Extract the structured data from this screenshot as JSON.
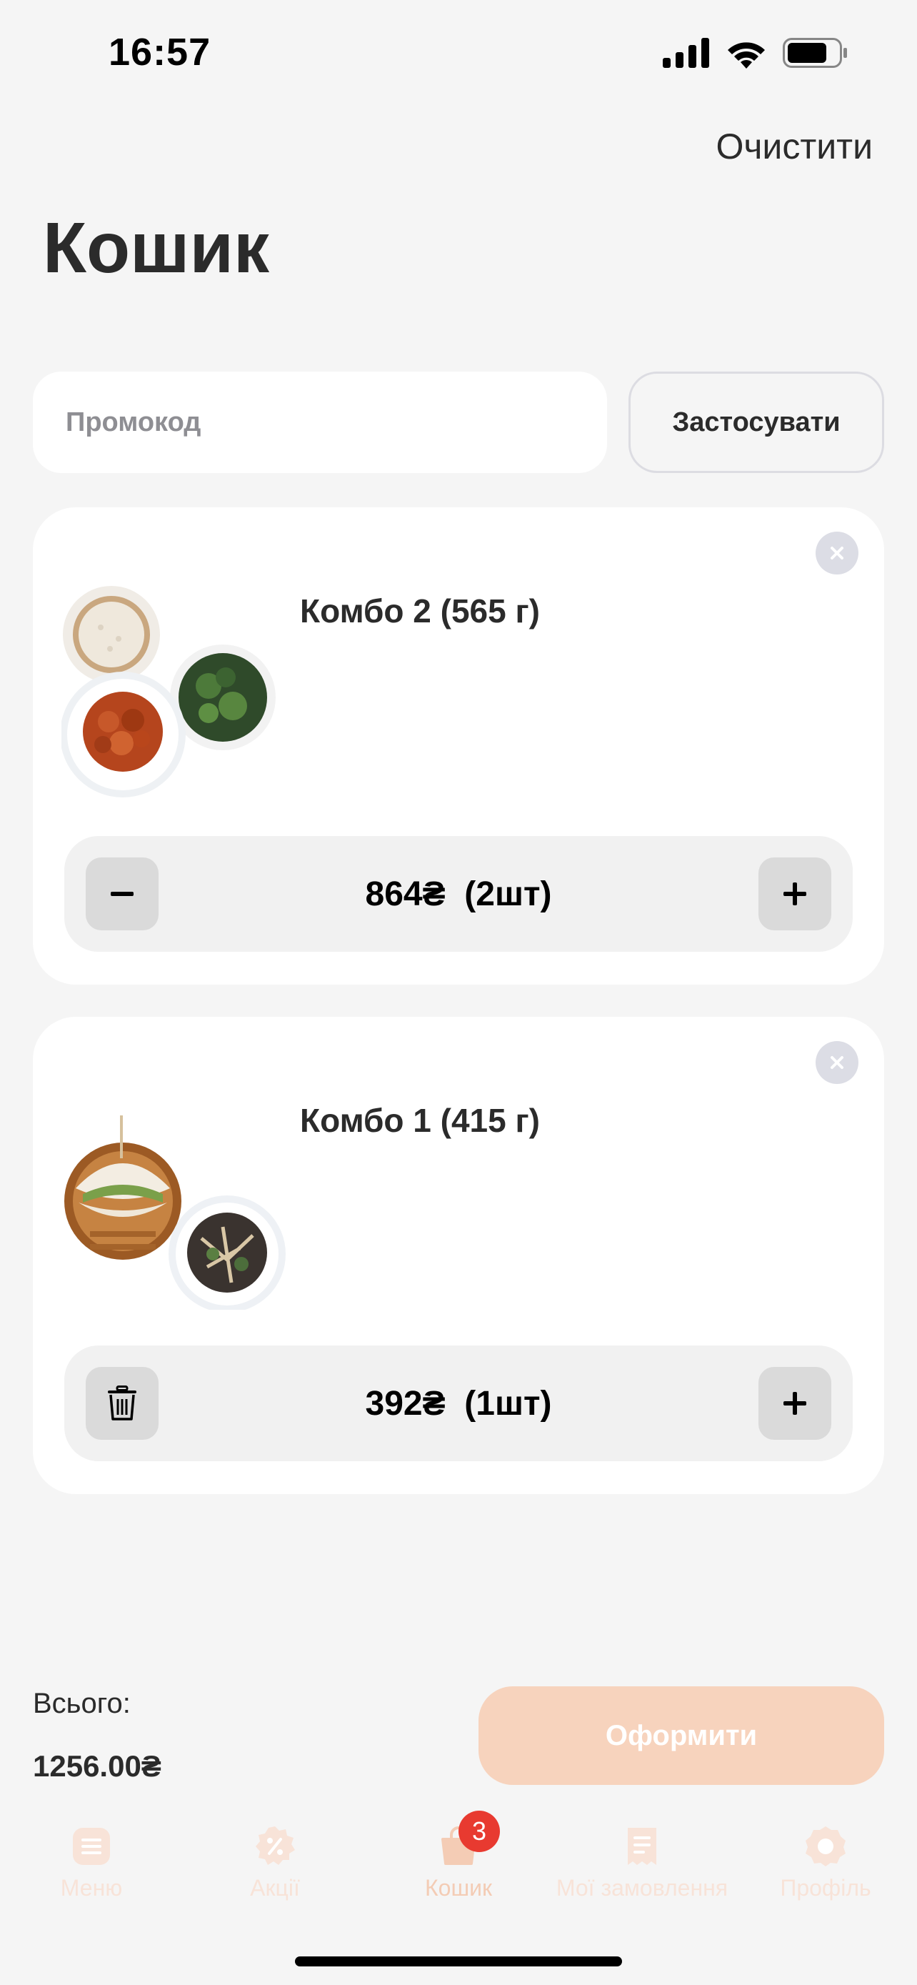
{
  "status_bar": {
    "time": "16:57"
  },
  "header": {
    "clear_label": "Очистити",
    "title": "Кошик"
  },
  "promo": {
    "placeholder": "Промокод",
    "value": "",
    "apply_label": "Застосувати"
  },
  "items": [
    {
      "name": "Комбо 2 (565 г)",
      "price": "864₴",
      "quantity": "(2шт)",
      "left_control": "minus-icon"
    },
    {
      "name": "Комбо 1 (415 г)",
      "price": "392₴",
      "quantity": "(1шт)",
      "left_control": "trash-icon"
    }
  ],
  "summary": {
    "total_label": "Всього:",
    "total_value": "1256.00₴",
    "checkout_label": "Оформити"
  },
  "tab_bar": {
    "tabs": [
      {
        "label": "Меню",
        "icon": "menu-icon"
      },
      {
        "label": "Акції",
        "icon": "discount-icon"
      },
      {
        "label": "Кошик",
        "icon": "cart-icon",
        "active": true
      },
      {
        "label": "Мої замовлення",
        "icon": "orders-icon"
      },
      {
        "label": "Профіль",
        "icon": "profile-icon"
      }
    ],
    "cart_badge": "3"
  },
  "colors": {
    "accent": "#f7d3bd",
    "badge": "#e83a30",
    "background": "#f5f5f5",
    "card": "#ffffff"
  }
}
